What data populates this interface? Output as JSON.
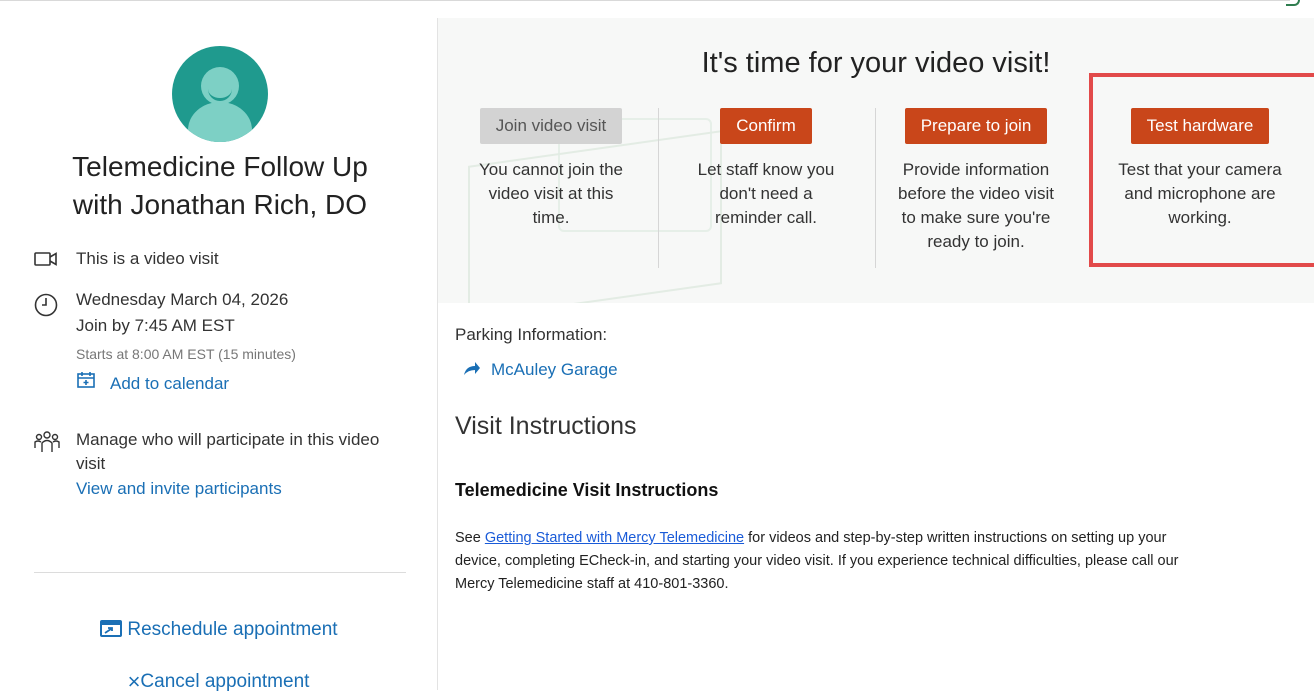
{
  "appointment": {
    "title_line1": "Telemedicine Follow Up",
    "title_line2": "with Jonathan Rich, DO",
    "visit_type": "This is a video visit",
    "date": "Wednesday March 04, 2026",
    "join_by": "Join by 7:45 AM EST",
    "starts_at": "Starts at 8:00 AM EST (15 minutes)",
    "add_to_calendar": "Add to calendar",
    "participants_text_line1": "Manage who will participate in this video",
    "participants_text_line2": "visit",
    "view_invite": "View and invite participants",
    "reschedule": "Reschedule appointment",
    "cancel": "Cancel appointment"
  },
  "banner": {
    "headline": "It's time for your video visit!",
    "cards": [
      {
        "button": "Join video visit",
        "desc_lines": [
          "You cannot join the",
          "video visit at this",
          "time."
        ],
        "disabled": true
      },
      {
        "button": "Confirm",
        "desc_lines": [
          "Let staff know you",
          "don't need a",
          "reminder call."
        ],
        "disabled": false
      },
      {
        "button": "Prepare to join",
        "desc_lines": [
          "Provide information",
          "before the video visit",
          "to make sure you're",
          "ready to join."
        ],
        "disabled": false
      },
      {
        "button": "Test hardware",
        "desc_lines": [
          "Test that your camera",
          "and microphone are",
          "working."
        ],
        "disabled": false
      }
    ],
    "highlight_color": "#e24a4a",
    "button_color": "#c9461a"
  },
  "parking": {
    "label": "Parking Information:",
    "link": "McAuley Garage"
  },
  "visit_instructions": {
    "heading": "Visit Instructions",
    "subheading": "Telemedicine Visit Instructions",
    "text_before": "See ",
    "link_text": "Getting Started with Mercy Telemedicine",
    "text_after_line1": " for videos and step-by-step written instructions on setting up your",
    "line2": "device, completing ECheck-in, and starting your video visit. If you experience technical difficulties, please call our",
    "line3": "Mercy Telemedicine staff at 410-801-3360."
  },
  "icons": {
    "video": "video-camera-icon",
    "clock": "clock-icon",
    "calendar": "calendar-add-icon",
    "participants": "participants-icon",
    "reschedule": "reschedule-icon",
    "cancel": "close-icon",
    "directions": "directions-arrow-icon"
  }
}
